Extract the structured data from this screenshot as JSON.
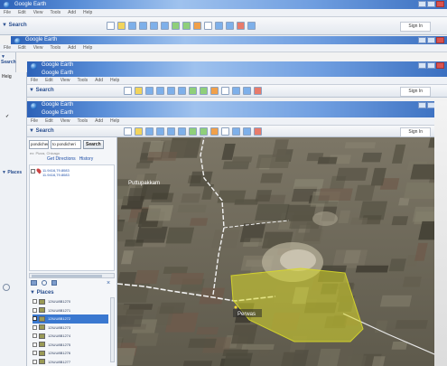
{
  "window": {
    "title": "Google Earth"
  },
  "menu": [
    "File",
    "Edit",
    "View",
    "Tools",
    "Add",
    "Help"
  ],
  "search": {
    "header": "▼ Search",
    "query_value": "pondicheri",
    "query_value2": "to pondicheri",
    "button_label": "Search",
    "hint": "ex: Pizza, Chicago",
    "get_directions_label": "Get Directions",
    "history_label": "History",
    "result_line1": "11.9416,79.8083",
    "result_line2": "11.9416,79.8083"
  },
  "signin_label": "Sign In",
  "places": {
    "header": "▼ Places",
    "items": [
      "12IUU8B1270",
      "12IUU8B1271",
      "12IUU8B1272",
      "12IUU8B1273",
      "12IUU8B1274",
      "12IUU8B1275",
      "12IUU8B1276",
      "12IUU8B1277",
      "12IUU8B1278"
    ],
    "selected_index": 2
  },
  "map": {
    "label_village": "Puttupakkam",
    "label_place": "Perwas",
    "overlay_color": "#d8d82a"
  },
  "colors": {
    "accent": "#2d62b8",
    "selection": "#3a78d0"
  }
}
